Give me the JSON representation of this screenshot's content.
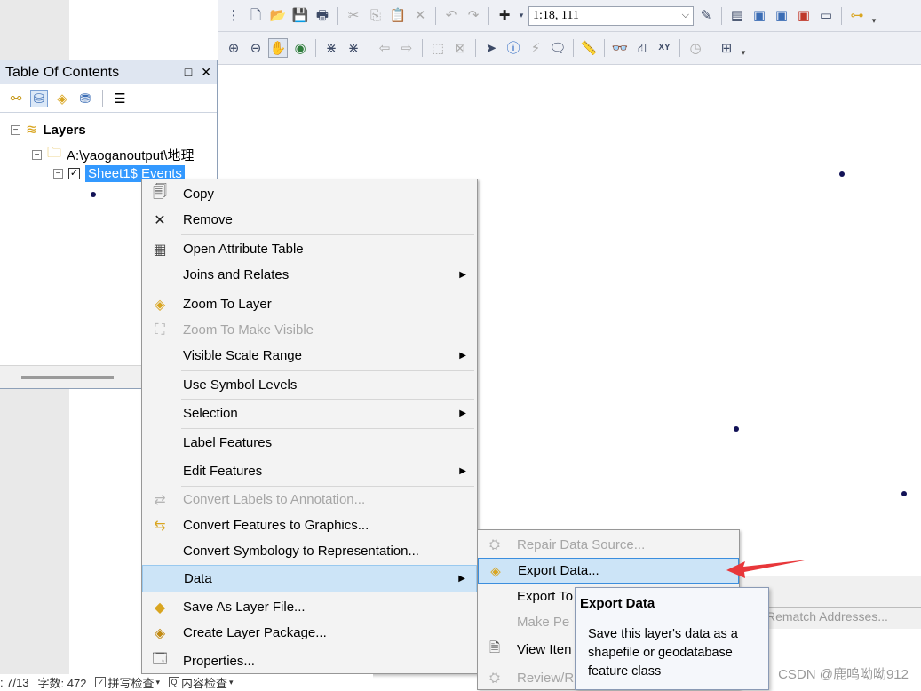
{
  "toolbar1": {
    "scale_value": "1:18, 111"
  },
  "toc": {
    "title": "Table Of Contents",
    "minimize": "□",
    "close": "✕",
    "layers_label": "Layers",
    "folder_label": "A:\\yaoganoutput\\地理",
    "layer_label": "Sheet1$ Events"
  },
  "context_menu": {
    "items": [
      {
        "label": "Copy",
        "icon": "copy-icon"
      },
      {
        "label": "Remove",
        "icon": "remove-icon"
      },
      {
        "label": "Open Attribute Table",
        "icon": "table-icon"
      },
      {
        "label": "Joins and Relates",
        "icon": ""
      },
      {
        "label": "Zoom To Layer",
        "icon": "zoom-layer-icon"
      },
      {
        "label": "Zoom To Make Visible",
        "icon": "zoom-visible-icon"
      },
      {
        "label": "Visible Scale Range",
        "icon": ""
      },
      {
        "label": "Use Symbol Levels",
        "icon": ""
      },
      {
        "label": "Selection",
        "icon": ""
      },
      {
        "label": "Label Features",
        "icon": ""
      },
      {
        "label": "Edit Features",
        "icon": ""
      },
      {
        "label": "Convert Labels to Annotation...",
        "icon": "convert-labels-icon"
      },
      {
        "label": "Convert Features to Graphics...",
        "icon": "convert-graphics-icon"
      },
      {
        "label": "Convert Symbology to Representation...",
        "icon": ""
      },
      {
        "label": "Data",
        "icon": ""
      },
      {
        "label": "Save As Layer File...",
        "icon": "layer-file-icon"
      },
      {
        "label": "Create Layer Package...",
        "icon": "layer-package-icon"
      },
      {
        "label": "Properties...",
        "icon": "properties-icon"
      }
    ]
  },
  "submenu": {
    "items": [
      {
        "label": "Repair Data Source..."
      },
      {
        "label": "Export Data..."
      },
      {
        "label": "Export To"
      },
      {
        "label": "Make Pe"
      },
      {
        "label": "View Iten"
      },
      {
        "label": "Review/R"
      }
    ]
  },
  "tooltip": {
    "title": "Export Data",
    "description": "Save this layer's data as a shapefile or geodatabase feature class"
  },
  "behind_window": {
    "text": "Rematch Addresses..."
  },
  "statusbar": {
    "page": ": 7/13",
    "word_count": "字数: 472",
    "spell_check": "拼写检查",
    "content_check": "内容检查"
  },
  "watermark": "CSDN @鹿鸣呦呦912",
  "colors": {
    "selection": "#3399ff",
    "highlight": "#cce4f7",
    "point": "#121257",
    "arrow": "#e8373a"
  }
}
